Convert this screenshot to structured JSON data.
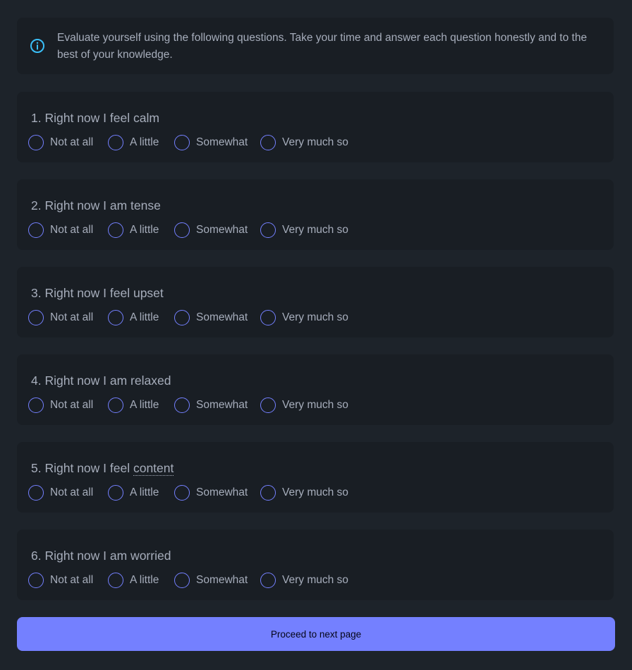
{
  "info": {
    "icon": "info-icon",
    "text": "Evaluate yourself using the following questions. Take your time and answer each question honestly and to the best of your knowledge."
  },
  "questions": [
    {
      "number": "1.",
      "prefix": "Right now I feel calm",
      "dotted": "",
      "options": [
        "Not at all",
        "A little",
        "Somewhat",
        "Very much so"
      ],
      "selected": null
    },
    {
      "number": "2.",
      "prefix": "Right now I am tense",
      "dotted": "",
      "options": [
        "Not at all",
        "A little",
        "Somewhat",
        "Very much so"
      ],
      "selected": null
    },
    {
      "number": "3.",
      "prefix": "Right now I feel upset",
      "dotted": "",
      "options": [
        "Not at all",
        "A little",
        "Somewhat",
        "Very much so"
      ],
      "selected": null
    },
    {
      "number": "4.",
      "prefix": "Right now I am relaxed",
      "dotted": "",
      "options": [
        "Not at all",
        "A little",
        "Somewhat",
        "Very much so"
      ],
      "selected": null
    },
    {
      "number": "5.",
      "prefix": "Right now I feel ",
      "dotted": "content",
      "options": [
        "Not at all",
        "A little",
        "Somewhat",
        "Very much so"
      ],
      "selected": null
    },
    {
      "number": "6.",
      "prefix": "Right now I am worried",
      "dotted": "",
      "options": [
        "Not at all",
        "A little",
        "Somewhat",
        "Very much so"
      ],
      "selected": null
    }
  ],
  "proceed_button": {
    "label": "Proceed to next page"
  },
  "colors": {
    "background": "#1d232a",
    "card": "#191e24",
    "text": "#a6adbb",
    "accent": "#7480ff",
    "info_icon": "#3abff8"
  }
}
